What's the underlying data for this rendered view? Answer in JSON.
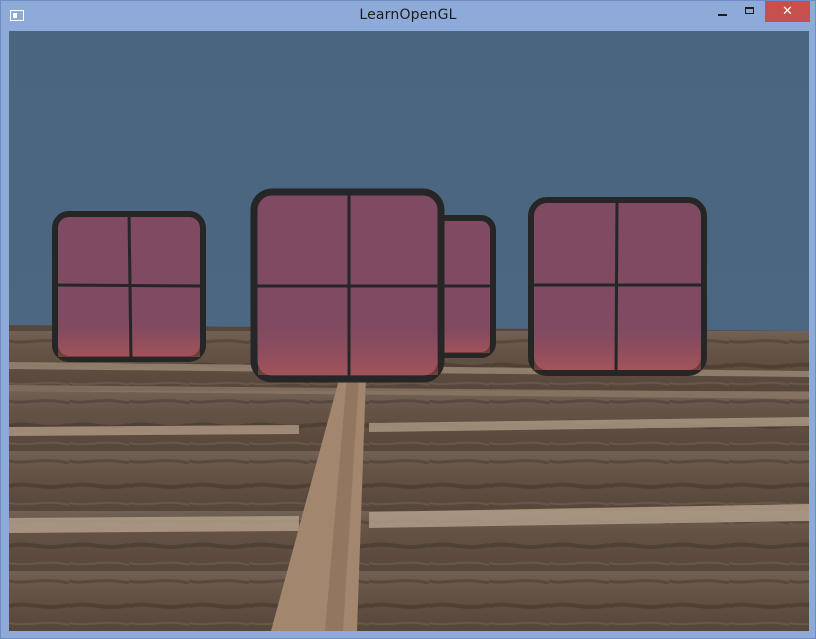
{
  "window": {
    "title": "LearnOpenGL",
    "icons": {
      "app": "app-window-icon",
      "minimize": "minimize-icon",
      "maximize": "maximize-icon",
      "close": "close-icon"
    },
    "close_glyph": "✕"
  },
  "scene": {
    "clear_color": "#4b6680",
    "floor_color": "#6e5a4a",
    "window_tint": "#7f4a62",
    "window_frame_color": "#262626",
    "window_count": 4
  }
}
